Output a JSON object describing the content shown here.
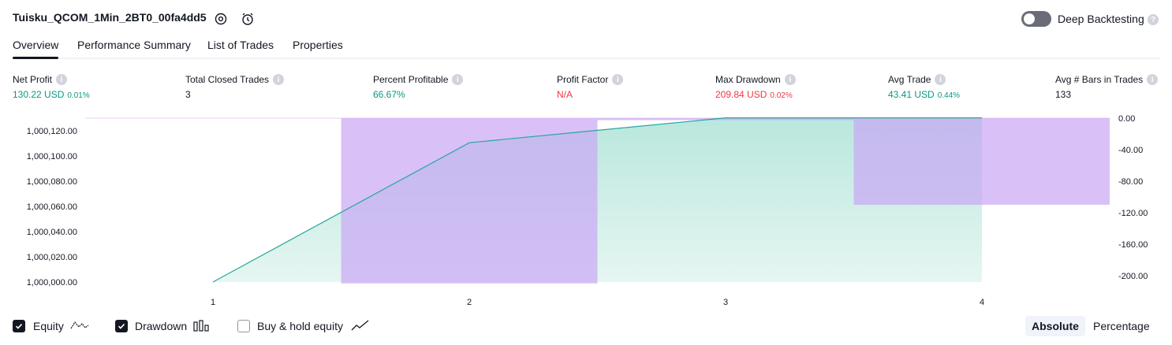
{
  "header": {
    "strategy_title": "Tuisku_QCOM_1Min_2BT0_00fa4dd5",
    "deep_backtesting_label": "Deep Backtesting",
    "deep_backtesting_enabled": false
  },
  "tabs": [
    {
      "label": "Overview",
      "active": true
    },
    {
      "label": "Performance Summary",
      "active": false
    },
    {
      "label": "List of Trades",
      "active": false
    },
    {
      "label": "Properties",
      "active": false
    }
  ],
  "metrics": {
    "net_profit": {
      "label": "Net Profit",
      "value": "130.22 USD",
      "pct": "0.01%"
    },
    "total_closed_trades": {
      "label": "Total Closed Trades",
      "value": "3"
    },
    "percent_profitable": {
      "label": "Percent Profitable",
      "value": "66.67%"
    },
    "profit_factor": {
      "label": "Profit Factor",
      "value": "N/A"
    },
    "max_drawdown": {
      "label": "Max Drawdown",
      "value": "209.84 USD",
      "pct": "0.02%"
    },
    "avg_trade": {
      "label": "Avg Trade",
      "value": "43.41 USD",
      "pct": "0.44%"
    },
    "avg_bars": {
      "label": "Avg # Bars in Trades",
      "value": "133"
    }
  },
  "colors": {
    "equity_line": "#26a69a",
    "equity_fill": "#d5f0e9",
    "drawdown_fill": "#c9a7f5",
    "positive": "#089981",
    "negative": "#f23645"
  },
  "chart_data": {
    "type": "area",
    "x": [
      1,
      2,
      3,
      4
    ],
    "x_ticks": [
      "1",
      "2",
      "3",
      "4"
    ],
    "left_axis": {
      "ticks": [
        "1,000,120.00",
        "1,000,100.00",
        "1,000,080.00",
        "1,000,060.00",
        "1,000,040.00",
        "1,000,020.00",
        "1,000,000.00"
      ],
      "ylim": [
        1000000,
        1000130
      ]
    },
    "right_axis": {
      "ticks": [
        "0.00",
        "-40.00",
        "-80.00",
        "-120.00",
        "-160.00",
        "-200.00"
      ],
      "ylim": [
        -209.84,
        0
      ]
    },
    "series": [
      {
        "name": "Equity",
        "axis": "left",
        "values": [
          1000000,
          1000110.5,
          1000130.22,
          1000130.22
        ]
      },
      {
        "name": "Drawdown",
        "axis": "right",
        "values": [
          0,
          -209.84,
          -2.5,
          -110
        ]
      }
    ]
  },
  "legend": {
    "equity": {
      "label": "Equity",
      "checked": true
    },
    "drawdown": {
      "label": "Drawdown",
      "checked": true
    },
    "buy_hold": {
      "label": "Buy & hold equity",
      "checked": false
    }
  },
  "scale_toggle": {
    "absolute": "Absolute",
    "percentage": "Percentage",
    "selected": "Absolute"
  }
}
